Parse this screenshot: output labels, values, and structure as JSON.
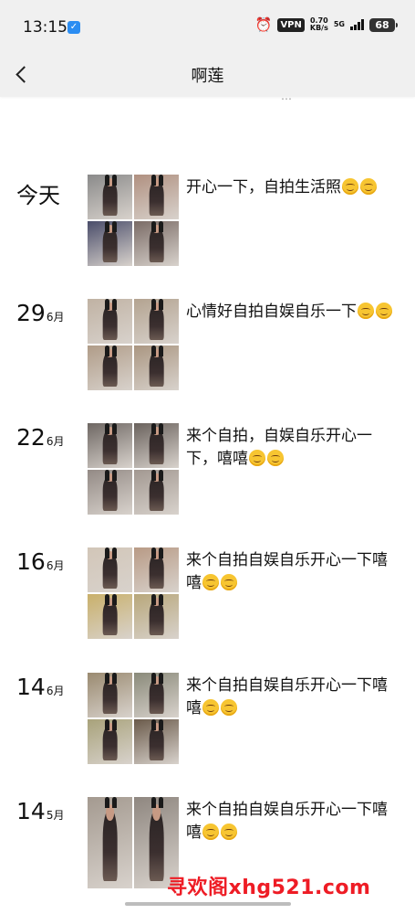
{
  "status_bar": {
    "time": "13:15",
    "app_badge_icon": "message-app-icon",
    "alarm_icon": "alarm-clock-icon",
    "vpn": "VPN",
    "speed_value": "0.70",
    "speed_unit": "KB/s",
    "network": "5G",
    "battery": "68"
  },
  "header": {
    "back_icon": "chevron-left-icon",
    "title": "啊莲"
  },
  "cut_off_text": "…",
  "posts": [
    {
      "date_label": "今天",
      "text": "开心一下，自拍生活照",
      "smiles": 2,
      "photos": [
        "#8a8a8a",
        "#b09080",
        "#4a4d6a",
        "#7a6b66"
      ]
    },
    {
      "day": "29",
      "month": "6月",
      "text": "心情好自拍自娱自乐一下",
      "smiles": 2,
      "photos": [
        "#c0b2a3",
        "#b3a390",
        "#b09c88",
        "#aa9681"
      ]
    },
    {
      "day": "22",
      "month": "6月",
      "text": "来个自拍，自娱自乐开心一下，嘻嘻",
      "smiles": 2,
      "photos": [
        "#6e6763",
        "#6a625d",
        "#938a85",
        "#a29891"
      ]
    },
    {
      "day": "16",
      "month": "6月",
      "text": "来个自拍自娱自乐开心一下嘻嘻",
      "smiles": 2,
      "photos": [
        "#d2c6b8",
        "#b89a85",
        "#c9b06a",
        "#b8a77a"
      ]
    },
    {
      "day": "14",
      "month": "6月",
      "text": "来个自拍自娱自乐开心一下嘻嘻",
      "smiles": 2,
      "photos": [
        "#9a8a70",
        "#8a8a7a",
        "#a8a27a",
        "#6a5a4a"
      ]
    },
    {
      "day": "14",
      "month": "5月",
      "text": "来个自拍自娱自乐开心一下嘻嘻",
      "smiles": 2,
      "photos": [
        "#a49a90",
        "#8f8780"
      ]
    }
  ],
  "watermark": "寻欢阁xhg521.com",
  "colors": {
    "bar_bg": "#f0f0f0",
    "emoji": "#f7c531",
    "watermark": "#ee1c25"
  }
}
